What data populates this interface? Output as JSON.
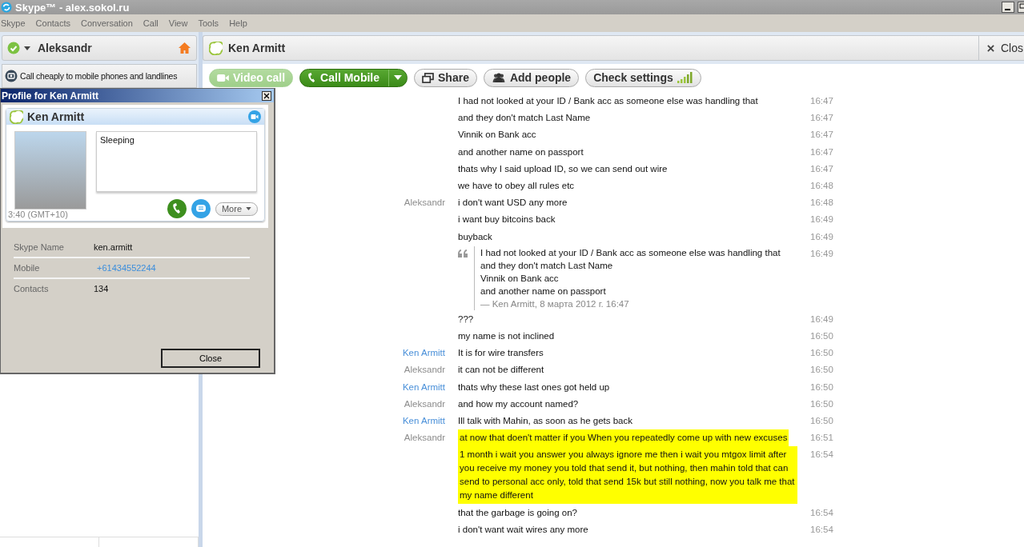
{
  "window": {
    "title": "Skype™ - alex.sokol.ru"
  },
  "menu": [
    "Skype",
    "Contacts",
    "Conversation",
    "Call",
    "View",
    "Tools",
    "Help"
  ],
  "account": {
    "name": "Aleksandr",
    "promo": "Call cheaply to mobile phones and landlines"
  },
  "conversation": {
    "title": "Ken Armitt",
    "close_label": "Clos"
  },
  "toolbar": [
    {
      "kind": "video",
      "label": "Video call",
      "disabled": true
    },
    {
      "kind": "call",
      "label": "Call Mobile",
      "disabled": false
    },
    {
      "kind": "share",
      "label": "Share",
      "disabled": false
    },
    {
      "kind": "people",
      "label": "Add people",
      "disabled": false
    },
    {
      "kind": "settings",
      "label": "Check settings",
      "disabled": false
    }
  ],
  "messages": [
    {
      "text": "I had not looked at your ID / Bank acc as someone else was handling that",
      "time": "16:47",
      "highlighted": false
    },
    {
      "text": "and they don't match Last Name",
      "time": "16:47",
      "highlighted": false
    },
    {
      "text": "Vinnik on Bank acc",
      "time": "16:47",
      "highlighted": false
    },
    {
      "text": "and another name on passport",
      "time": "16:47",
      "highlighted": false
    },
    {
      "text": "thats why I said upload ID, so we can send out wire",
      "time": "16:47",
      "highlighted": false
    },
    {
      "text": "we have to obey all rules etc",
      "time": "16:48",
      "highlighted": false
    },
    {
      "sender": "Aleksandr",
      "color": "#8c8c8c",
      "text": "i don't want USD any more",
      "time": "16:48",
      "highlighted": false
    },
    {
      "text": "i want buy bitcoins back",
      "time": "16:49",
      "highlighted": false
    },
    {
      "text": "buyback",
      "time": "16:49",
      "highlighted": false
    },
    {
      "kind": "quote",
      "lines": [
        "I had not looked at your ID / Bank acc as someone else was handling that",
        "and they don't match Last Name",
        "Vinnik on Bank acc",
        "and another name on passport"
      ],
      "attribution": "— Ken Armitt, 8 марта 2012 г. 16:47",
      "time": "16:49"
    },
    {
      "text": "???",
      "time": "16:49",
      "highlighted": false
    },
    {
      "text": "my name is not inclined",
      "time": "16:50",
      "highlighted": false
    },
    {
      "sender": "Ken Armitt",
      "color": "#4a90d9",
      "text": "It is for wire transfers",
      "time": "16:50",
      "highlighted": false
    },
    {
      "sender": "Aleksandr",
      "color": "#8c8c8c",
      "text": "it can not be different",
      "time": "16:50",
      "highlighted": false
    },
    {
      "sender": "Ken Armitt",
      "color": "#4a90d9",
      "text": "thats why these last ones got held up",
      "time": "16:50",
      "highlighted": false
    },
    {
      "sender": "Aleksandr",
      "color": "#8c8c8c",
      "text": "and how my account named?",
      "time": "16:50",
      "highlighted": false
    },
    {
      "sender": "Ken Armitt",
      "color": "#4a90d9",
      "text": "Ill talk with Mahin, as soon as he gets back",
      "time": "16:50",
      "highlighted": false
    },
    {
      "sender": "Aleksandr",
      "color": "#8c8c8c",
      "text": "at now that doen't matter if you When you repeatedly come up with new excuses",
      "time": "16:51",
      "highlighted": true
    },
    {
      "text": "1 month i wait you answer you always ignore me then i wait you mtgox limit after you receive my money you told that send it, but nothing, then mahin told that can send to personal acc only, told that send 15k but still nothing, now you talk me that my name different",
      "time": "16:54",
      "highlighted": true
    },
    {
      "text": "that the garbage is going on?",
      "time": "16:54",
      "highlighted": false
    },
    {
      "text": "i don't want wait wires any more",
      "time": "16:54",
      "highlighted": false
    }
  ],
  "profile": {
    "title": "Profile for Ken Armitt",
    "name": "Ken Armitt",
    "mood": "Sleeping",
    "local_time": "3:40 (GMT+10)",
    "more_label": "More",
    "fields": [
      {
        "label": "Skype Name",
        "value": "ken.armitt",
        "kind": "text"
      },
      {
        "label": "Mobile",
        "value": "+61434552244",
        "kind": "link"
      },
      {
        "label": "Contacts",
        "value": "134",
        "kind": "text"
      }
    ],
    "close_label": "Close"
  }
}
